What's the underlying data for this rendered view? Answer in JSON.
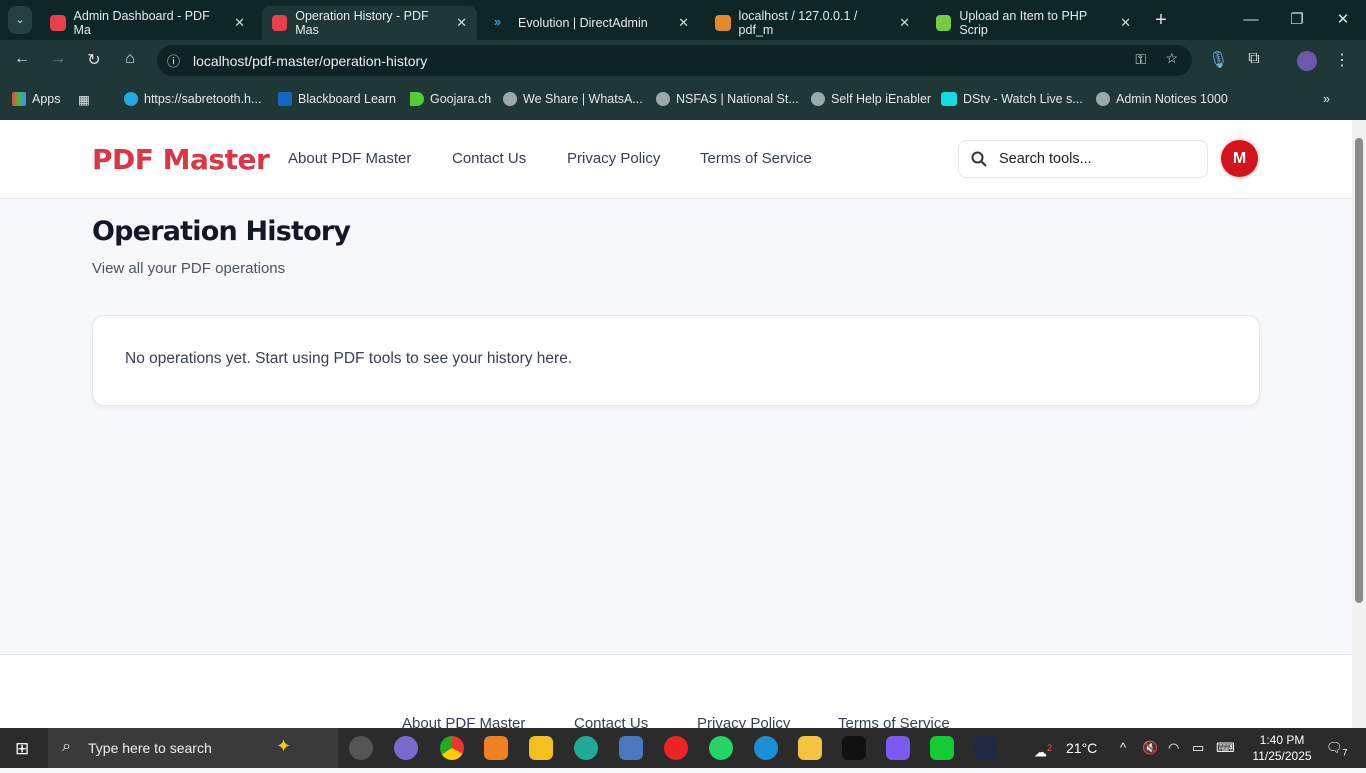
{
  "browser": {
    "tabs": [
      {
        "title": "Admin Dashboard - PDF Ma",
        "color": "#e8404a",
        "active": false
      },
      {
        "title": "Operation History - PDF Mas",
        "color": "#e8404a",
        "active": true
      },
      {
        "title": "Evolution | DirectAdmin",
        "color": "#2aa7e0",
        "active": false
      },
      {
        "title": "localhost / 127.0.0.1 / pdf_m",
        "color": "#e58a2a",
        "active": false
      },
      {
        "title": "Upload an Item to PHP Scrip",
        "color": "#7ac943",
        "active": false
      }
    ],
    "url": "localhost/pdf-master/operation-history",
    "bookmarks": [
      "Apps",
      "https://sabretooth.h...",
      "Blackboard Learn",
      "Goojara.ch",
      "We Share | WhatsA...",
      "NSFAS | National St...",
      "Self Help iEnabler",
      "DStv - Watch Live s...",
      "Admin Notices 1000"
    ]
  },
  "site": {
    "logo": "PDF Master",
    "nav": [
      "About PDF Master",
      "Contact Us",
      "Privacy Policy",
      "Terms of Service"
    ],
    "search_placeholder": "Search tools...",
    "avatar_initial": "M",
    "brand_color": "#dc3545"
  },
  "main": {
    "title": "Operation History",
    "subtitle": "View all your PDF operations",
    "empty_message": "No operations yet. Start using PDF tools to see your history here."
  },
  "footer": {
    "links": [
      "About PDF Master",
      "Contact Us",
      "Privacy Policy",
      "Terms of Service"
    ]
  },
  "taskbar": {
    "search_placeholder": "Type here to search",
    "weather": "21°C",
    "weather_badge": "2",
    "time": "1:40 PM",
    "date": "11/25/2025",
    "notifications": "7"
  }
}
